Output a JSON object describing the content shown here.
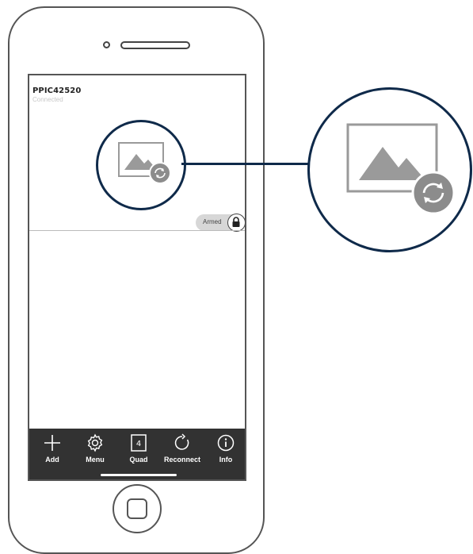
{
  "device": {
    "name": "PPIC42520",
    "status": "Connected"
  },
  "feed": {
    "armed_label": "Armed",
    "lock_icon": "lock-icon",
    "snapshot_icon": "image-refresh-icon"
  },
  "toolbar": {
    "items": [
      {
        "label": "Add",
        "icon": "plus-icon"
      },
      {
        "label": "Menu",
        "icon": "gear-icon"
      },
      {
        "label": "Quad",
        "icon": "quad-view-icon",
        "icon_text": "4"
      },
      {
        "label": "Reconnect",
        "icon": "reconnect-icon"
      },
      {
        "label": "Info",
        "icon": "info-icon"
      }
    ]
  },
  "colors": {
    "accent": "#0f2a4a",
    "toolbar_bg": "#323232",
    "image_gray": "#9a9a9a",
    "refresh_badge": "#8c8c8c"
  }
}
